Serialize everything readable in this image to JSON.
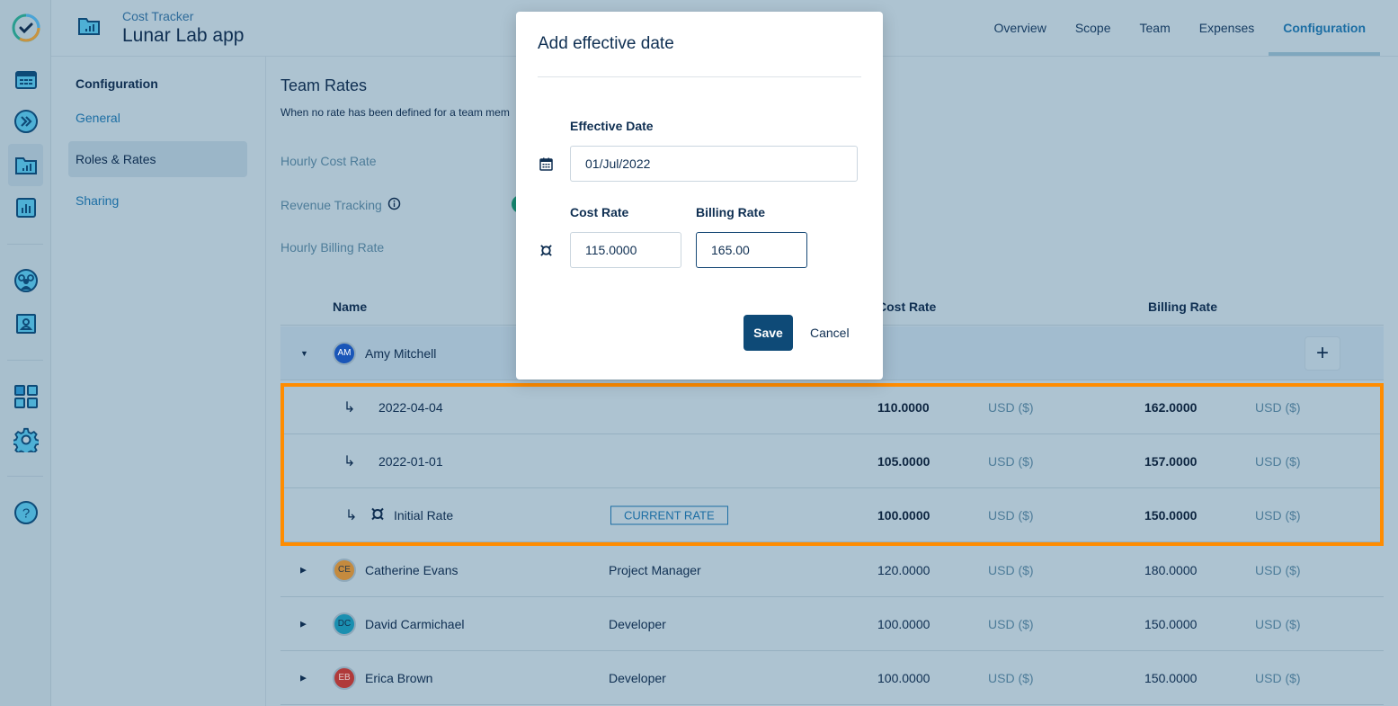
{
  "rail": {
    "items": [
      "app-logo",
      "calendar",
      "fast-forward",
      "projects",
      "reports",
      "team",
      "contacts",
      "apps-grid",
      "settings",
      "help"
    ]
  },
  "header": {
    "subtitle": "Cost Tracker",
    "title": "Lunar Lab app",
    "tabs": [
      {
        "label": "Overview",
        "active": false
      },
      {
        "label": "Scope",
        "active": false
      },
      {
        "label": "Team",
        "active": false
      },
      {
        "label": "Expenses",
        "active": false
      },
      {
        "label": "Configuration",
        "active": true
      }
    ]
  },
  "sidebar": {
    "title": "Configuration",
    "items": [
      {
        "label": "General",
        "active": false
      },
      {
        "label": "Roles & Rates",
        "active": true
      },
      {
        "label": "Sharing",
        "active": false
      }
    ]
  },
  "main": {
    "section_title": "Team Rates",
    "section_desc": "When no rate has been defined for a team mem",
    "fields": {
      "hourly_cost_rate": "Hourly Cost Rate",
      "revenue_tracking": "Revenue Tracking",
      "hourly_billing_rate": "Hourly Billing Rate"
    },
    "revenue_tracking_enabled": true,
    "table": {
      "headers": {
        "name": "Name",
        "cost_rate": "Cost Rate",
        "billing_rate": "Billing Rate"
      },
      "expanded_member": {
        "initials": "AM",
        "name": "Amy Mitchell",
        "avatar_color": "#1a56b8",
        "add_label": "+"
      },
      "sub_rows": [
        {
          "label": "2022-04-04",
          "badge": "",
          "cost": "110.0000",
          "cost_cur": "USD ($)",
          "bill": "162.0000",
          "bill_cur": "USD ($)"
        },
        {
          "label": "2022-01-01",
          "badge": "",
          "cost": "105.0000",
          "cost_cur": "USD ($)",
          "bill": "157.0000",
          "bill_cur": "USD ($)"
        },
        {
          "label": "Initial Rate",
          "badge": "CURRENT RATE",
          "cost": "100.0000",
          "cost_cur": "USD ($)",
          "bill": "150.0000",
          "bill_cur": "USD ($)"
        }
      ],
      "members": [
        {
          "initials": "CE",
          "name": "Catherine Evans",
          "role": "Project Manager",
          "cost": "120.0000",
          "cost_cur": "USD ($)",
          "bill": "180.0000",
          "bill_cur": "USD ($)",
          "avatar_color": "#c48a3e"
        },
        {
          "initials": "DC",
          "name": "David Carmichael",
          "role": "Developer",
          "cost": "100.0000",
          "cost_cur": "USD ($)",
          "bill": "150.0000",
          "bill_cur": "USD ($)",
          "avatar_color": "#1a8fb0"
        },
        {
          "initials": "EB",
          "name": "Erica Brown",
          "role": "Developer",
          "cost": "100.0000",
          "cost_cur": "USD ($)",
          "bill": "150.0000",
          "bill_cur": "USD ($)",
          "avatar_color": "#b03a3a"
        }
      ]
    }
  },
  "modal": {
    "title": "Add effective date",
    "effective_date_label": "Effective Date",
    "effective_date_value": "01/Jul/2022",
    "cost_rate_label": "Cost Rate",
    "cost_rate_value": "115.0000",
    "billing_rate_label": "Billing Rate",
    "billing_rate_value": "165.00",
    "save_label": "Save",
    "cancel_label": "Cancel"
  },
  "colors": {
    "accent": "#1c6ea4",
    "primary_button": "#0e4a77",
    "highlight": "#ff8c00",
    "toggle_on": "#168a72"
  }
}
